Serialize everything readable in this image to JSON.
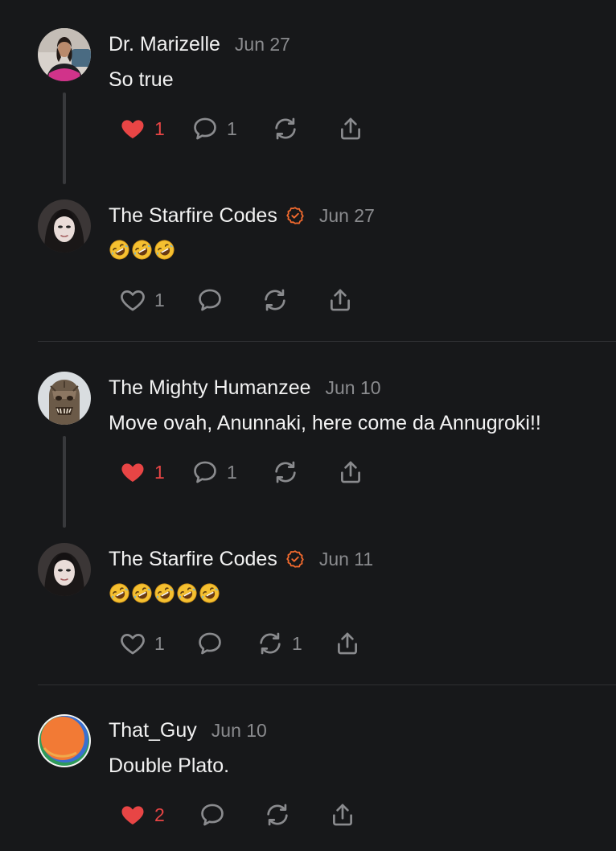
{
  "colors": {
    "background": "#17181a",
    "like": "#e84545",
    "muted": "#8a8b8e",
    "verified": "#f26a2e"
  },
  "posts": [
    {
      "name": "Dr. Marizelle",
      "date": "Jun 27",
      "text": "So true",
      "likes": "1",
      "comments": "1",
      "restacks": "",
      "liked": true,
      "verified": false
    },
    {
      "name": "The Starfire Codes",
      "date": "Jun 27",
      "emoji": "🤣🤣🤣",
      "likes": "1",
      "comments": "",
      "restacks": "",
      "liked": false,
      "verified": true
    },
    {
      "name": "The Mighty Humanzee",
      "date": "Jun 10",
      "text": "Move ovah, Anunnaki, here come da Annugroki!!",
      "likes": "1",
      "comments": "1",
      "restacks": "",
      "liked": true,
      "verified": false
    },
    {
      "name": "The Starfire Codes",
      "date": "Jun 11",
      "emoji": "🤣🤣🤣🤣🤣",
      "likes": "1",
      "comments": "",
      "restacks": "1",
      "liked": false,
      "verified": true
    },
    {
      "name": "That_Guy",
      "date": "Jun 10",
      "text": "Double Plato.",
      "likes": "2",
      "comments": "",
      "restacks": "",
      "liked": true,
      "verified": false
    }
  ],
  "icons": {
    "like": "heart-icon",
    "comment": "comment-bubble-icon",
    "restack": "restack-icon",
    "share": "share-icon",
    "verified": "verified-check-icon",
    "emoji": "rolling-on-floor-laughing-emoji"
  }
}
